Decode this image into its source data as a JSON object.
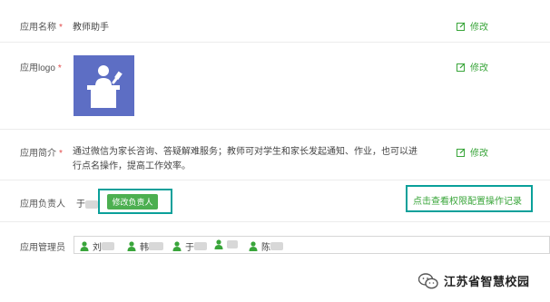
{
  "app_name": {
    "label": "应用名称",
    "required_mark": "*",
    "value": "教师助手",
    "edit_label": "修改"
  },
  "app_logo": {
    "label": "应用logo",
    "required_mark": "*",
    "edit_label": "修改"
  },
  "app_intro": {
    "label": "应用简介",
    "required_mark": "*",
    "value": "通过微信为家长咨询、答疑解难服务；教师可对学生和家长发起通知、作业，也可以进行点名操作，提高工作效率。",
    "edit_label": "修改"
  },
  "app_owner": {
    "label": "应用负责人",
    "name_prefix": "于",
    "change_button": "修改负责人",
    "permission_link": "点击查看权限配置操作记录"
  },
  "app_admins": {
    "label": "应用管理员",
    "items": [
      {
        "name_prefix": "刘"
      },
      {
        "name_prefix": "韩"
      },
      {
        "name_prefix": "于"
      },
      {
        "name_prefix": "陈"
      }
    ]
  },
  "watermark": {
    "text": "江苏省智慧校园",
    "icon": "wechat-icon"
  },
  "colors": {
    "accent": "#39a53a",
    "highlight": "#0aa09a",
    "logo_bg": "#5d6ec4",
    "required": "#e24a4a"
  }
}
